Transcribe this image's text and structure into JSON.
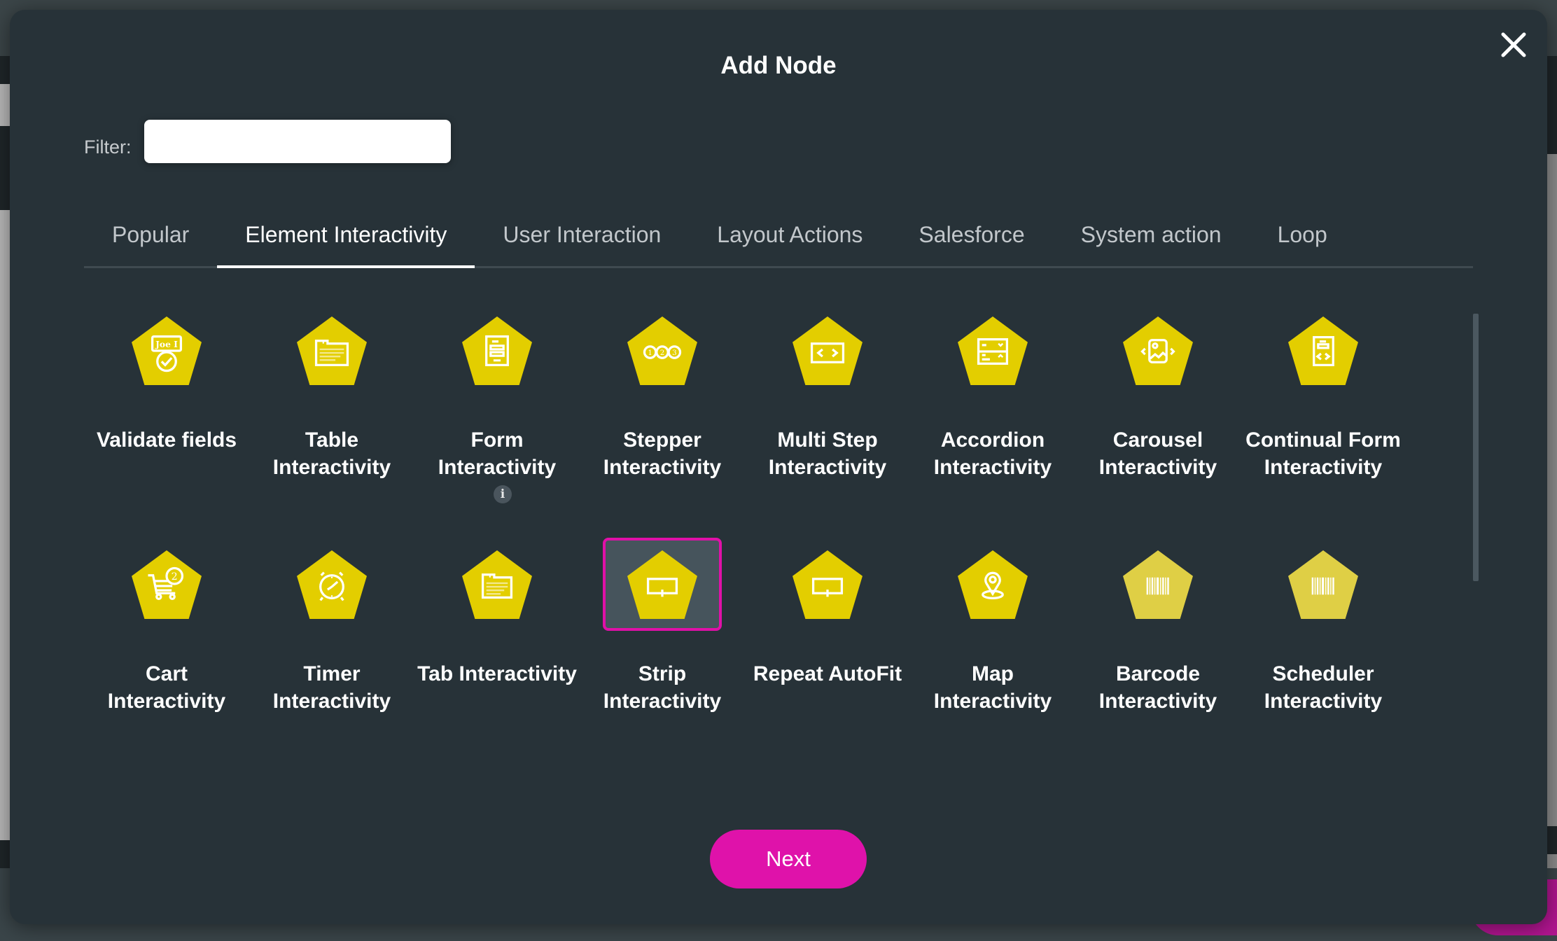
{
  "modal": {
    "title": "Add Node",
    "close_icon": "close-icon"
  },
  "filter": {
    "label": "Filter:",
    "value": "",
    "placeholder": ""
  },
  "tabs": [
    {
      "label": "Popular",
      "active": false
    },
    {
      "label": "Element Interactivity",
      "active": true
    },
    {
      "label": "User Interaction",
      "active": false
    },
    {
      "label": "Layout Actions",
      "active": false
    },
    {
      "label": "Salesforce",
      "active": false
    },
    {
      "label": "System action",
      "active": false
    },
    {
      "label": "Loop",
      "active": false
    }
  ],
  "nodes": [
    {
      "label": "Validate fields",
      "icon": "validate-fields-icon",
      "info": false,
      "selected": false,
      "muted": false
    },
    {
      "label": "Table Interactivity",
      "icon": "table-icon",
      "info": false,
      "selected": false,
      "muted": false
    },
    {
      "label": "Form Interactivity",
      "icon": "form-icon",
      "info": true,
      "selected": false,
      "muted": false
    },
    {
      "label": "Stepper Interactivity",
      "icon": "stepper-icon",
      "info": false,
      "selected": false,
      "muted": false
    },
    {
      "label": "Multi Step Interactivity",
      "icon": "multi-step-icon",
      "info": false,
      "selected": false,
      "muted": false
    },
    {
      "label": "Accordion Interactivity",
      "icon": "accordion-icon",
      "info": false,
      "selected": false,
      "muted": false
    },
    {
      "label": "Carousel Interactivity",
      "icon": "carousel-icon",
      "info": false,
      "selected": false,
      "muted": false
    },
    {
      "label": "Continual Form Interactivity",
      "icon": "continual-form-icon",
      "info": false,
      "selected": false,
      "muted": false
    },
    {
      "label": "Cart Interactivity",
      "icon": "cart-icon",
      "info": false,
      "selected": false,
      "muted": false
    },
    {
      "label": "Timer Interactivity",
      "icon": "timer-icon",
      "info": false,
      "selected": false,
      "muted": false
    },
    {
      "label": "Tab Interactivity",
      "icon": "tab-icon",
      "info": false,
      "selected": false,
      "muted": false
    },
    {
      "label": "Strip Interactivity",
      "icon": "strip-icon",
      "info": false,
      "selected": true,
      "muted": false
    },
    {
      "label": "Repeat AutoFit",
      "icon": "repeat-autofit-icon",
      "info": false,
      "selected": false,
      "muted": false
    },
    {
      "label": "Map Interactivity",
      "icon": "map-pin-icon",
      "info": false,
      "selected": false,
      "muted": false
    },
    {
      "label": "Barcode Interactivity",
      "icon": "barcode-icon",
      "info": false,
      "selected": false,
      "muted": true
    },
    {
      "label": "Scheduler Interactivity",
      "icon": "barcode-icon",
      "info": false,
      "selected": false,
      "muted": true
    }
  ],
  "info_glyph": "i",
  "next_button": {
    "label": "Next"
  },
  "colors": {
    "modal_bg": "#273238",
    "accent": "#df12aa",
    "node_yellow": "#e3ce00",
    "node_yellow_muted": "#dfcf45",
    "selected_bg": "#46545c"
  }
}
